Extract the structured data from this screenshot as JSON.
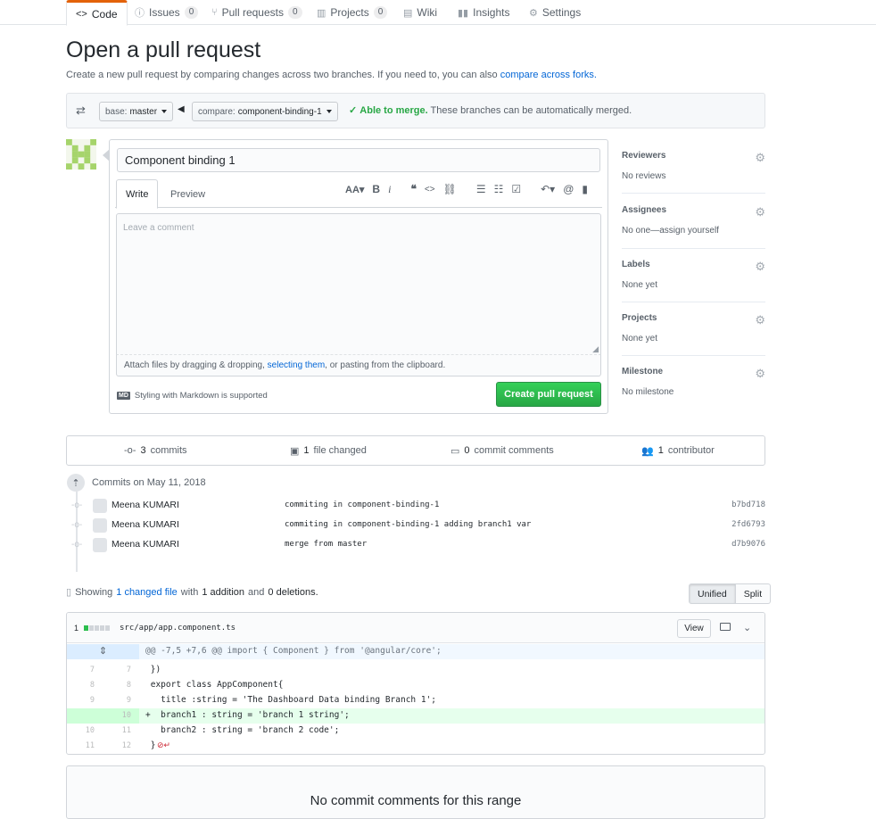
{
  "repo_nav": {
    "tabs": [
      {
        "label": "Code",
        "icon": "code-icon"
      },
      {
        "label": "Issues",
        "count": "0",
        "icon": "issue-icon"
      },
      {
        "label": "Pull requests",
        "count": "0",
        "icon": "pull-request-icon"
      },
      {
        "label": "Projects",
        "count": "0",
        "icon": "project-icon"
      },
      {
        "label": "Wiki",
        "icon": "book-icon"
      },
      {
        "label": "Insights",
        "icon": "graph-icon"
      },
      {
        "label": "Settings",
        "icon": "gear-icon"
      }
    ]
  },
  "page": {
    "title": "Open a pull request",
    "subtitle": "Create a new pull request by comparing changes across two branches. If you need to, you can also",
    "subtitle_link": "compare across forks."
  },
  "range": {
    "base_label": "base:",
    "base_value": "master",
    "compare_label": "compare:",
    "compare_value": "component-binding-1",
    "merge_status": "Able to merge.",
    "merge_note": "These branches can be automatically merged."
  },
  "form": {
    "title_value": "Component binding 1",
    "tab_write": "Write",
    "tab_preview": "Preview",
    "toolbar": [
      "AA▾",
      "B",
      "i",
      "❝",
      "<>",
      "⛓",
      "☰",
      "☷",
      "☑",
      "↶▾",
      "@",
      "🔖"
    ],
    "comment_placeholder": "Leave a comment",
    "attach_prefix": "Attach files by dragging & dropping,",
    "attach_link": "selecting them",
    "attach_suffix": ", or pasting from the clipboard.",
    "markdown_badge": "MD",
    "markdown_note": "Styling with Markdown is supported",
    "submit_label": "Create pull request"
  },
  "sidebar": [
    {
      "title": "Reviewers",
      "value": "No reviews"
    },
    {
      "title": "Assignees",
      "value": "No one—assign yourself"
    },
    {
      "title": "Labels",
      "value": "None yet"
    },
    {
      "title": "Projects",
      "value": "None yet"
    },
    {
      "title": "Milestone",
      "value": "No milestone"
    }
  ],
  "stats": {
    "commits": "3",
    "commits_label": "commits",
    "files": "1",
    "files_label": "file changed",
    "comments": "0",
    "comments_label": "commit comments",
    "contributors": "1",
    "contributors_label": "contributor"
  },
  "commits_header": "Commits on May 11, 2018",
  "commits": [
    {
      "author": "Meena KUMARI",
      "message": "commiting in component-binding-1",
      "sha": "b7bd718"
    },
    {
      "author": "Meena KUMARI",
      "message": "commiting in component-binding-1 adding branch1 var",
      "sha": "2fd6793"
    },
    {
      "author": "Meena KUMARI",
      "message": "merge from master",
      "sha": "d7b9076"
    }
  ],
  "diff_summary": {
    "prefix": "Showing",
    "link": "1 changed file",
    "mid": "with",
    "additions": "1 addition",
    "and": "and",
    "deletions": "0 deletions."
  },
  "view_toggle": {
    "unified": "Unified",
    "split": "Split"
  },
  "file": {
    "count": "1",
    "path": "src/app/app.component.ts",
    "view_label": "View",
    "hunk": "@@ -7,5 +7,6 @@ import { Component } from '@angular/core';"
  },
  "diff_lines": [
    {
      "old": "7",
      "new": "7",
      "text": " })"
    },
    {
      "old": "8",
      "new": "8",
      "text": " export class AppComponent{"
    },
    {
      "old": "9",
      "new": "9",
      "text": "   title :string = 'The Dashboard Data binding Branch 1';"
    },
    {
      "old": "",
      "new": "10",
      "text": "+  branch1 : string = 'branch 1 string';"
    },
    {
      "old": "10",
      "new": "11",
      "text": "   branch2 : string = 'branch 2 code';"
    },
    {
      "old": "11",
      "new": "12",
      "text": " }"
    }
  ],
  "no_comments": "No commit comments for this range"
}
